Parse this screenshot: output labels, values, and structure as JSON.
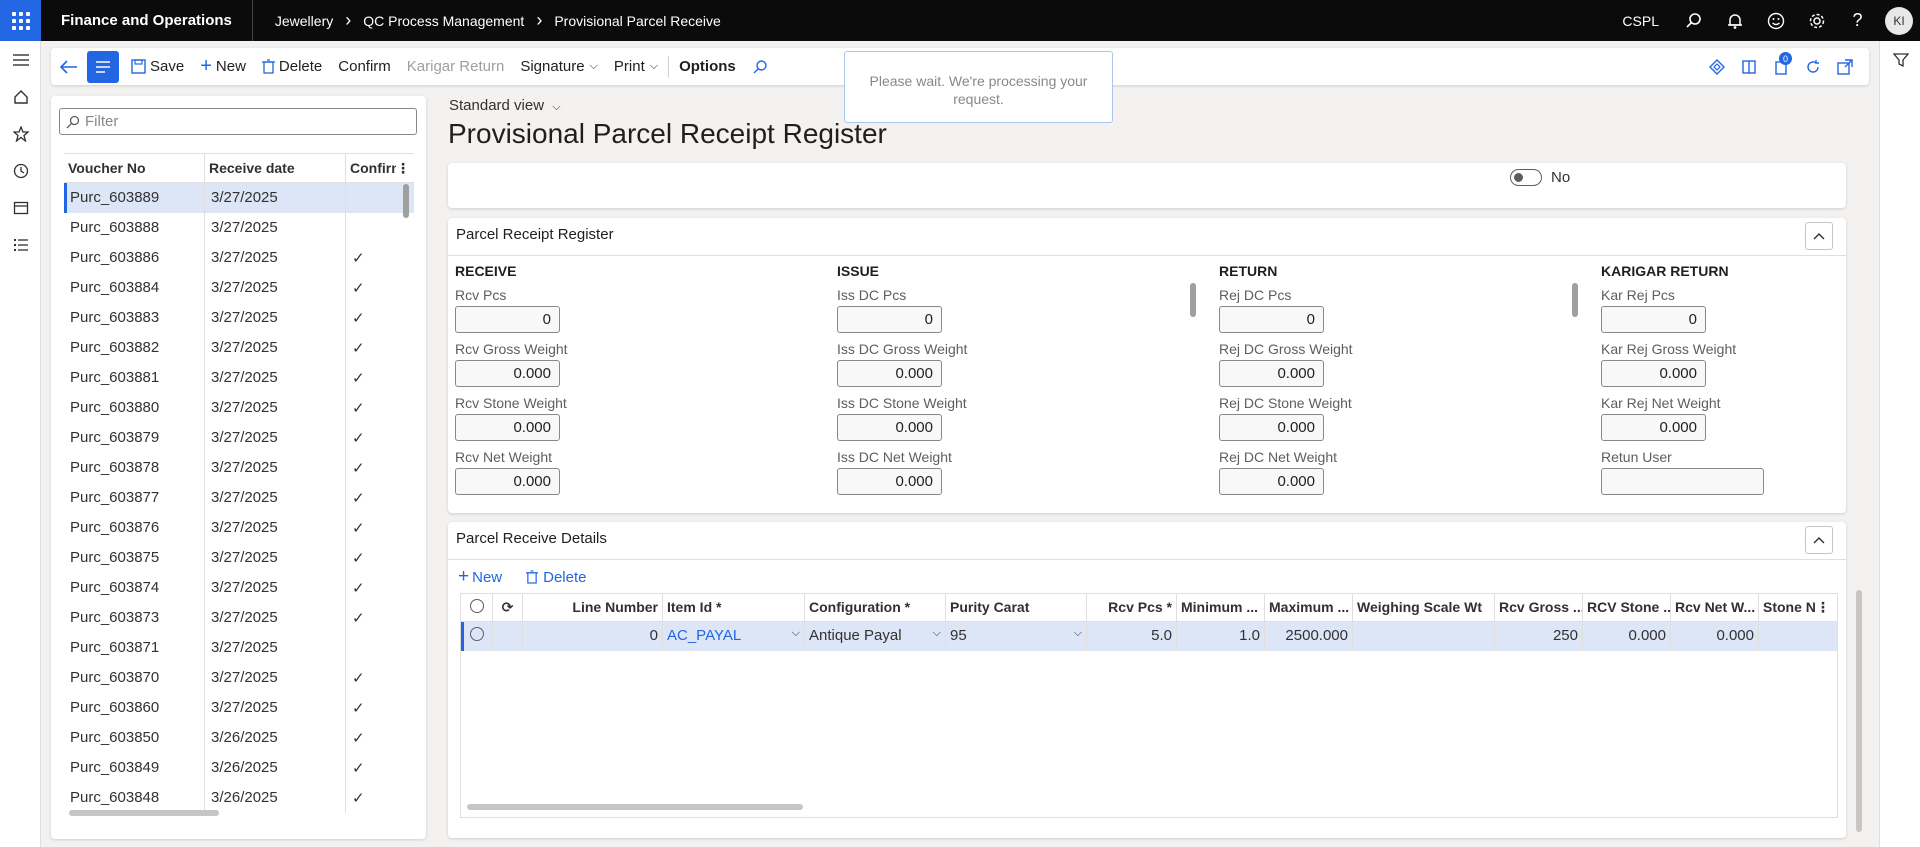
{
  "topbar": {
    "app_title": "Finance and Operations",
    "breadcrumb": [
      "Jewellery",
      "QC Process Management",
      "Provisional Parcel Receive"
    ],
    "company": "CSPL",
    "user_initials": "KI"
  },
  "actions": {
    "save": "Save",
    "new": "New",
    "delete": "Delete",
    "confirm": "Confirm",
    "karigar_return": "Karigar Return",
    "signature": "Signature",
    "print": "Print",
    "options": "Options",
    "notification_count": "0"
  },
  "busy_message": "Please wait. We're processing your request.",
  "list": {
    "filter_placeholder": "Filter",
    "columns": [
      "Voucher No",
      "Receive date",
      "Confirm"
    ],
    "rows": [
      {
        "voucher": "Purc_603889",
        "date": "3/27/2025",
        "confirmed": ""
      },
      {
        "voucher": "Purc_603888",
        "date": "3/27/2025",
        "confirmed": ""
      },
      {
        "voucher": "Purc_603886",
        "date": "3/27/2025",
        "confirmed": "✓"
      },
      {
        "voucher": "Purc_603884",
        "date": "3/27/2025",
        "confirmed": "✓"
      },
      {
        "voucher": "Purc_603883",
        "date": "3/27/2025",
        "confirmed": "✓"
      },
      {
        "voucher": "Purc_603882",
        "date": "3/27/2025",
        "confirmed": "✓"
      },
      {
        "voucher": "Purc_603881",
        "date": "3/27/2025",
        "confirmed": "✓"
      },
      {
        "voucher": "Purc_603880",
        "date": "3/27/2025",
        "confirmed": "✓"
      },
      {
        "voucher": "Purc_603879",
        "date": "3/27/2025",
        "confirmed": "✓"
      },
      {
        "voucher": "Purc_603878",
        "date": "3/27/2025",
        "confirmed": "✓"
      },
      {
        "voucher": "Purc_603877",
        "date": "3/27/2025",
        "confirmed": "✓"
      },
      {
        "voucher": "Purc_603876",
        "date": "3/27/2025",
        "confirmed": "✓"
      },
      {
        "voucher": "Purc_603875",
        "date": "3/27/2025",
        "confirmed": "✓"
      },
      {
        "voucher": "Purc_603874",
        "date": "3/27/2025",
        "confirmed": "✓"
      },
      {
        "voucher": "Purc_603873",
        "date": "3/27/2025",
        "confirmed": "✓"
      },
      {
        "voucher": "Purc_603871",
        "date": "3/27/2025",
        "confirmed": ""
      },
      {
        "voucher": "Purc_603870",
        "date": "3/27/2025",
        "confirmed": "✓"
      },
      {
        "voucher": "Purc_603860",
        "date": "3/27/2025",
        "confirmed": "✓"
      },
      {
        "voucher": "Purc_603850",
        "date": "3/26/2025",
        "confirmed": "✓"
      },
      {
        "voucher": "Purc_603849",
        "date": "3/26/2025",
        "confirmed": "✓"
      },
      {
        "voucher": "Purc_603848",
        "date": "3/26/2025",
        "confirmed": "✓"
      }
    ]
  },
  "view_selector": "Standard view",
  "page_title": "Provisional Parcel Receipt Register",
  "toggle_value": "No",
  "register": {
    "title": "Parcel Receipt Register",
    "columns": [
      {
        "heading": "RECEIVE",
        "fields": [
          {
            "label": "Rcv Pcs",
            "value": "0"
          },
          {
            "label": "Rcv Gross Weight",
            "value": "0.000"
          },
          {
            "label": "Rcv Stone Weight",
            "value": "0.000"
          },
          {
            "label": "Rcv Net Weight",
            "value": "0.000"
          }
        ]
      },
      {
        "heading": "ISSUE",
        "fields": [
          {
            "label": "Iss DC Pcs",
            "value": "0"
          },
          {
            "label": "Iss DC Gross Weight",
            "value": "0.000"
          },
          {
            "label": "Iss DC Stone Weight",
            "value": "0.000"
          },
          {
            "label": "Iss DC Net Weight",
            "value": "0.000"
          }
        ]
      },
      {
        "heading": "RETURN",
        "fields": [
          {
            "label": "Rej DC Pcs",
            "value": "0"
          },
          {
            "label": "Rej DC Gross Weight",
            "value": "0.000"
          },
          {
            "label": "Rej DC Stone Weight",
            "value": "0.000"
          },
          {
            "label": "Rej DC Net Weight",
            "value": "0.000"
          }
        ]
      },
      {
        "heading": "KARIGAR RETURN",
        "fields": [
          {
            "label": "Kar Rej Pcs",
            "value": "0"
          },
          {
            "label": "Kar Rej Gross Weight",
            "value": "0.000"
          },
          {
            "label": "Kar Rej Net Weight",
            "value": "0.000"
          },
          {
            "label": "Retun User",
            "value": ""
          }
        ]
      }
    ]
  },
  "details": {
    "title": "Parcel Receive Details",
    "new": "New",
    "delete": "Delete",
    "columns": [
      "Line Number",
      "Item Id *",
      "Configuration *",
      "Purity Carat",
      "Rcv Pcs *",
      "Minimum ...",
      "Maximum ...",
      "Weighing Scale Wt",
      "Rcv Gross ...",
      "RCV Stone ...",
      "Rcv Net W...",
      "Stone N"
    ],
    "rows": [
      {
        "line": "0",
        "item": "AC_PAYAL",
        "config": "Antique Payal",
        "purity": "95",
        "pcs": "5.0",
        "min": "1.0",
        "max": "2500.000",
        "scale": "",
        "gross": "250",
        "stone": "0.000",
        "net": "0.000",
        "stone_n": ""
      }
    ]
  }
}
